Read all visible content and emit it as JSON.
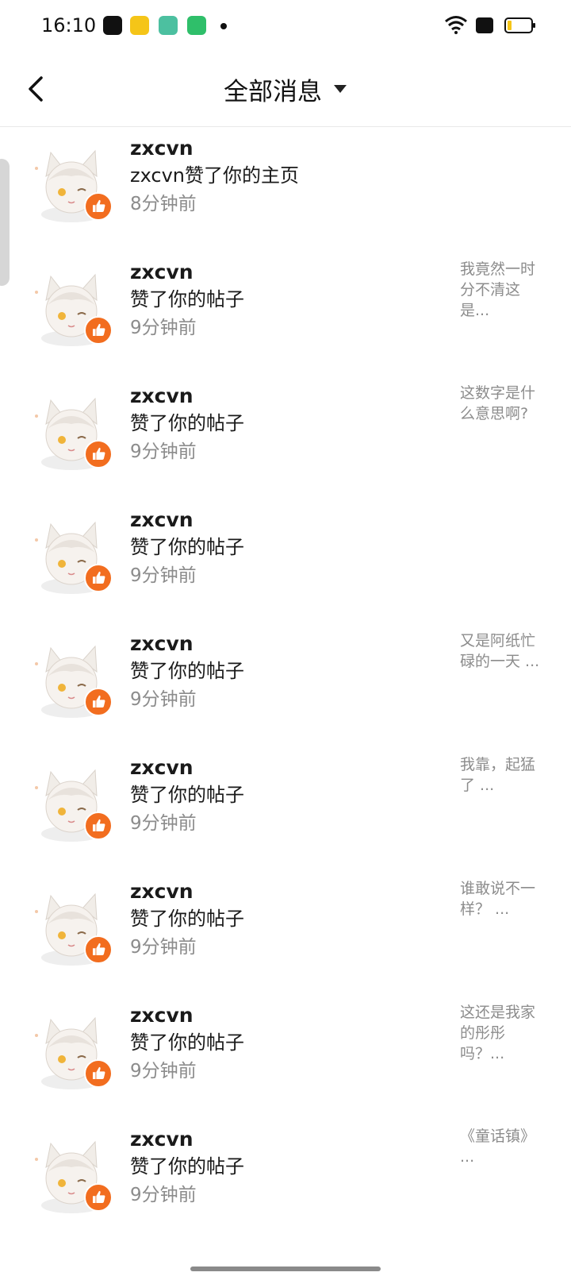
{
  "status_bar": {
    "time": "16:10"
  },
  "header": {
    "title": "全部消息"
  },
  "colors": {
    "like_badge": "#f26d1f",
    "secondary_text": "#8c8c8c"
  },
  "messages": [
    {
      "username": "zxcvn",
      "text": "zxcvn赞了你的主页",
      "time": "8分钟前",
      "preview": ""
    },
    {
      "username": "zxcvn",
      "text": "赞了你的帖子",
      "time": "9分钟前",
      "preview": "我竟然一时分不清这是..."
    },
    {
      "username": "zxcvn",
      "text": "赞了你的帖子",
      "time": "9分钟前",
      "preview": "这数字是什么意思啊?"
    },
    {
      "username": "zxcvn",
      "text": "赞了你的帖子",
      "time": "9分钟前",
      "preview": ""
    },
    {
      "username": "zxcvn",
      "text": "赞了你的帖子",
      "time": "9分钟前",
      "preview": "又是阿纸忙碌的一天 ..."
    },
    {
      "username": "zxcvn",
      "text": "赞了你的帖子",
      "time": "9分钟前",
      "preview": "我靠，起猛了 ..."
    },
    {
      "username": "zxcvn",
      "text": "赞了你的帖子",
      "time": "9分钟前",
      "preview": "谁敢说不一样？ ..."
    },
    {
      "username": "zxcvn",
      "text": "赞了你的帖子",
      "time": "9分钟前",
      "preview": "这还是我家的彤彤吗？..."
    },
    {
      "username": "zxcvn",
      "text": "赞了你的帖子",
      "time": "9分钟前",
      "preview": "《童话镇》 ..."
    }
  ]
}
